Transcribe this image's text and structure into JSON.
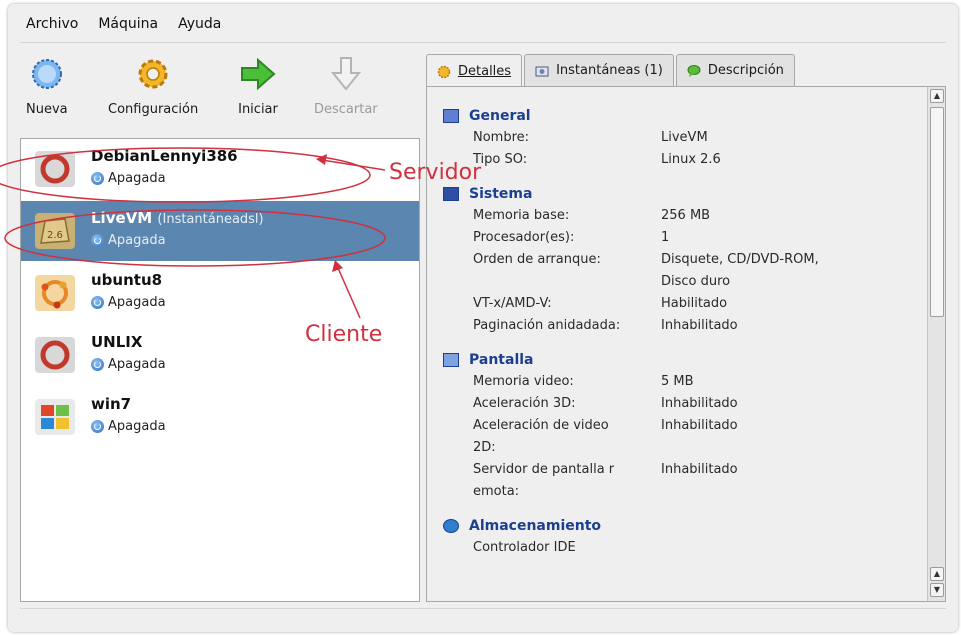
{
  "menu": [
    "Archivo",
    "Máquina",
    "Ayuda"
  ],
  "toolbar": {
    "new_label": "Nueva",
    "settings_label": "Configuración",
    "start_label": "Iniciar",
    "discard_label": "Descartar"
  },
  "vms": [
    {
      "name": "DebianLennyi386",
      "snapshot": "",
      "state": "Apagada",
      "selected": false,
      "icon": "debian-icon"
    },
    {
      "name": "LiveVM",
      "snapshot": "(Instantáneadsl)",
      "state": "Apagada",
      "selected": true,
      "icon": "linux-26-icon"
    },
    {
      "name": "ubuntu8",
      "snapshot": "",
      "state": "Apagada",
      "selected": false,
      "icon": "ubuntu-icon"
    },
    {
      "name": "UNLIX",
      "snapshot": "",
      "state": "Apagada",
      "selected": false,
      "icon": "debian-icon"
    },
    {
      "name": "win7",
      "snapshot": "",
      "state": "Apagada",
      "selected": false,
      "icon": "windows-icon"
    }
  ],
  "annotations": {
    "server": "Servidor",
    "client": "Cliente",
    "color": "#d0303f"
  },
  "tabs": [
    {
      "label": "Detalles",
      "active": true
    },
    {
      "label": "Instantáneas (1)",
      "active": false
    },
    {
      "label": "Descripción",
      "active": false
    }
  ],
  "details": {
    "general": {
      "title": "General",
      "rows": [
        {
          "key": "Nombre:",
          "value": "LiveVM"
        },
        {
          "key": "Tipo SO:",
          "value": "Linux 2.6"
        }
      ]
    },
    "system": {
      "title": "Sistema",
      "rows": [
        {
          "key": "Memoria base:",
          "value": "256 MB"
        },
        {
          "key": "Procesador(es):",
          "value": "1"
        },
        {
          "key": "Orden de arranque:",
          "value": "Disquete, CD/DVD-ROM,"
        },
        {
          "key": "",
          "value": "Disco duro"
        },
        {
          "key": "VT-x/AMD-V:",
          "value": "Habilitado"
        },
        {
          "key": "Paginación anidadada:",
          "value": "Inhabilitado"
        }
      ]
    },
    "display": {
      "title": "Pantalla",
      "rows": [
        {
          "key": "Memoria video:",
          "value": "5 MB"
        },
        {
          "key": "Aceleración 3D:",
          "value": "Inhabilitado"
        },
        {
          "key": "Aceleración de video",
          "value": "Inhabilitado"
        },
        {
          "key": "2D:",
          "value": ""
        },
        {
          "key": "Servidor de pantalla r",
          "value": "Inhabilitado"
        },
        {
          "key": "emota:",
          "value": ""
        }
      ]
    },
    "storage": {
      "title": "Almacenamiento",
      "rows": [
        {
          "key": "Controlador IDE",
          "value": ""
        }
      ]
    }
  },
  "colors": {
    "selection": "#5b86b0",
    "section_title": "#1d3f8f",
    "window_bg": "#efefef"
  }
}
